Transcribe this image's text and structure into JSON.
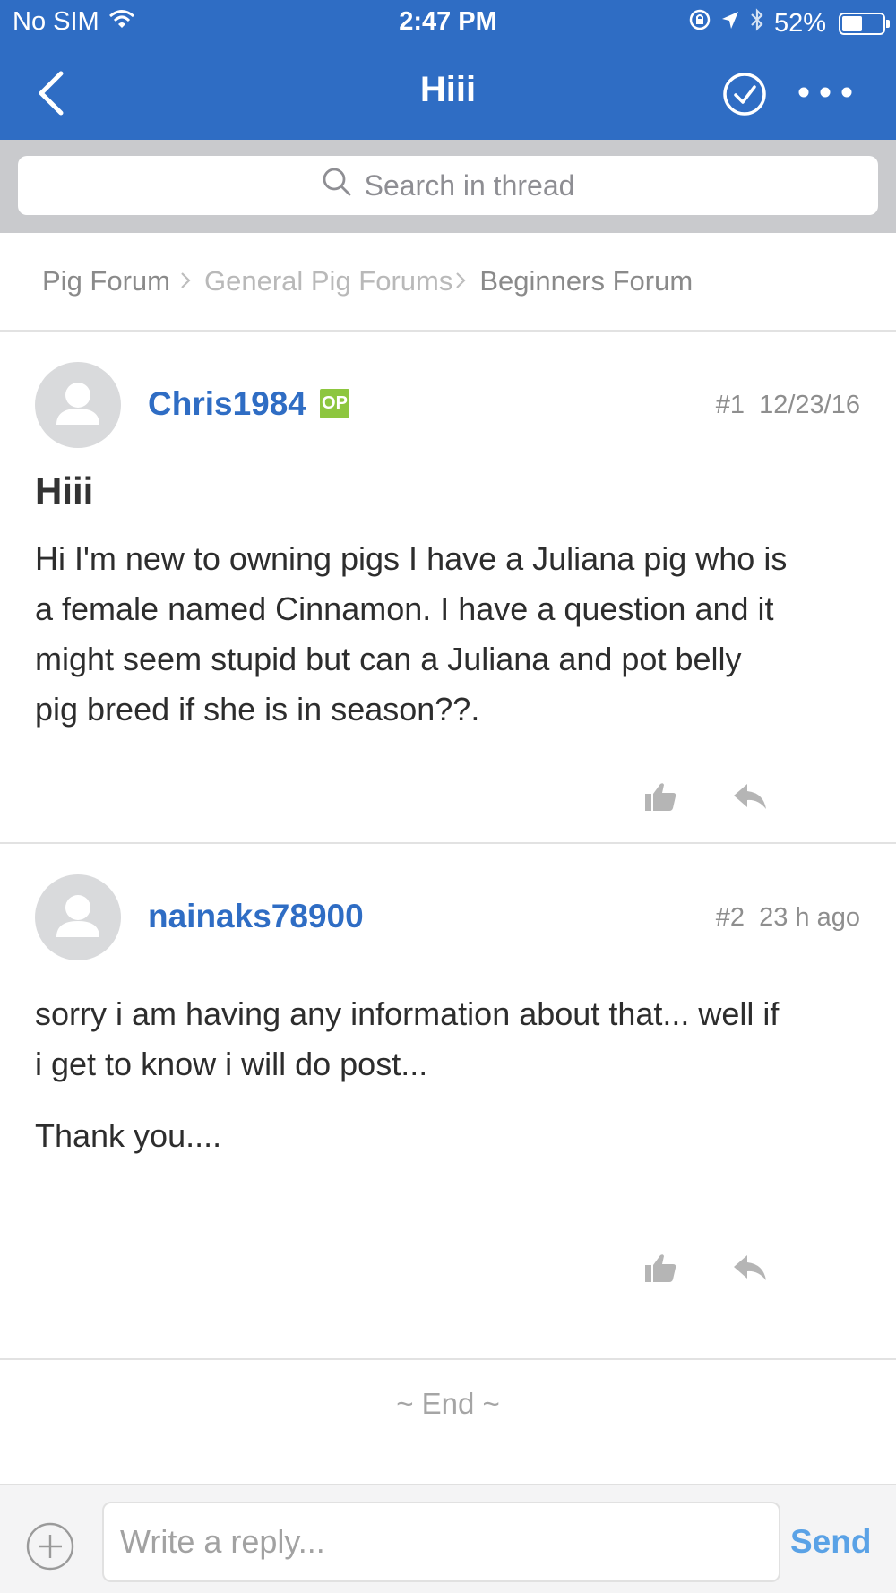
{
  "status_bar": {
    "carrier": "No SIM",
    "time": "2:47 PM",
    "battery": "52%",
    "battery_level": 0.52
  },
  "nav": {
    "title": "Hiii",
    "back_icon": "chevron-left-icon",
    "check_icon": "check-circle-icon",
    "more_icon": "more-horizontal-icon"
  },
  "search": {
    "placeholder": "Search in thread"
  },
  "breadcrumb": {
    "items": [
      "Pig Forum",
      "General Pig Forums",
      "Beginners Forum"
    ]
  },
  "posts": [
    {
      "username": "Chris1984",
      "badge": "OP",
      "number": "#1",
      "date": "12/23/16",
      "title": "Hiii",
      "body_lines": [
        "Hi I'm new to owning pigs I have a Juliana pig who is",
        "a female named Cinnamon.  I have a question and it",
        "might seem stupid but can a Juliana and pot belly",
        "pig breed if she is in season??."
      ]
    },
    {
      "username": "nainaks78900",
      "number": "#2",
      "date": "23 h ago",
      "body_lines": [
        "sorry i am having any information about that... well if",
        "i get to know i will do post..."
      ],
      "body_extra": "Thank you...."
    }
  ],
  "end_text": "~ End ~",
  "composer": {
    "placeholder": "Write a reply...",
    "send_label": "Send"
  },
  "colors": {
    "brand": "#2f6dc4",
    "op_badge": "#8dc63f",
    "send": "#5aa2e6"
  }
}
